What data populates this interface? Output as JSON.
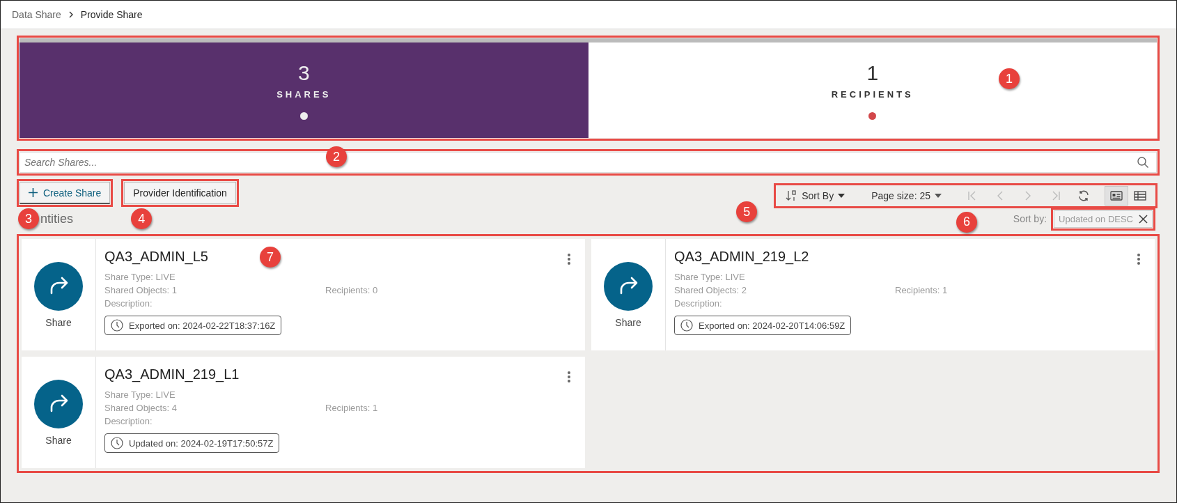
{
  "breadcrumb": [
    {
      "label": "Data Share",
      "current": false
    },
    {
      "label": "Provide Share",
      "current": true
    }
  ],
  "summary": {
    "callout": "1",
    "tiles": [
      {
        "value": "3",
        "label": "SHARES",
        "selected": true
      },
      {
        "value": "1",
        "label": "RECIPIENTS",
        "selected": false
      }
    ]
  },
  "search": {
    "placeholder": "Search Shares...",
    "callout": "2"
  },
  "actions": [
    {
      "label": "Create Share",
      "kind": "create",
      "callout": "3"
    },
    {
      "label": "Provider Identification",
      "kind": "plain",
      "callout": "4"
    }
  ],
  "toolbar": {
    "callout": "5",
    "sort_label": "Sort By",
    "page_size": "Page size: 25",
    "pager_disabled": true,
    "views": [
      {
        "kind": "card",
        "selected": true
      },
      {
        "kind": "table",
        "selected": false
      }
    ]
  },
  "section_title": "ntities",
  "sort_chip": {
    "label": "Sort by:",
    "value": "Updated on DESC",
    "callout": "6"
  },
  "cards": {
    "callout": "7",
    "items": [
      {
        "title": "QA3_ADMIN_L5",
        "icon_label": "Share",
        "share_type": "Share Type: LIVE",
        "objects": "Shared Objects: 1",
        "recipients": "Recipients: 0",
        "description": "Description:",
        "timestamp": "Exported on: 2024-02-22T18:37:16Z"
      },
      {
        "title": "QA3_ADMIN_219_L2",
        "icon_label": "Share",
        "share_type": "Share Type: LIVE",
        "objects": "Shared Objects: 2",
        "recipients": "Recipients: 1",
        "description": "Description:",
        "timestamp": "Exported on: 2024-02-20T14:06:59Z"
      },
      {
        "title": "QA3_ADMIN_219_L1",
        "icon_label": "Share",
        "share_type": "Share Type: LIVE",
        "objects": "Shared Objects: 4",
        "recipients": "Recipients: 1",
        "description": "Description:",
        "timestamp": "Updated on: 2024-02-19T17:50:57Z"
      }
    ]
  }
}
